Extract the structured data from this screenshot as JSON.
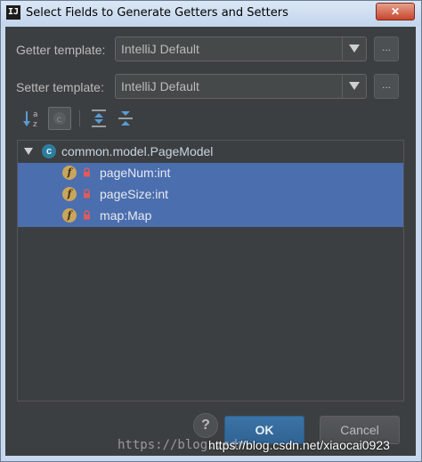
{
  "window": {
    "title": "Select Fields to Generate Getters and Setters",
    "app_icon": "IJ",
    "close_label": "✕"
  },
  "getter": {
    "label": "Getter template:",
    "value": "IntelliJ Default",
    "more_label": "..."
  },
  "setter": {
    "label": "Setter template:",
    "value": "IntelliJ Default",
    "more_label": "..."
  },
  "toolbar": {
    "icons": [
      "sort-alphabetically-icon",
      "show-classes-icon",
      "expand-all-icon",
      "collapse-all-icon"
    ]
  },
  "tree": {
    "root": {
      "label": "common.model.PageModel",
      "icon": "class-icon",
      "icon_letter": "c"
    },
    "fields": [
      {
        "label": "pageNum:int",
        "icon_letter": "f"
      },
      {
        "label": "pageSize:int",
        "icon_letter": "f"
      },
      {
        "label": "map:Map",
        "icon_letter": "f"
      }
    ]
  },
  "buttons": {
    "help": "?",
    "ok": "OK",
    "cancel": "Cancel"
  },
  "watermark": {
    "faded": "https://blog.csdn",
    "url": "https://blog.csdn.net/xiaocai0923"
  },
  "colors": {
    "background": "#3c3f41",
    "selection": "#4b6eaf",
    "primary_button": "#365880",
    "field_icon": "#c9a55d",
    "class_icon": "#2c7ea0"
  }
}
